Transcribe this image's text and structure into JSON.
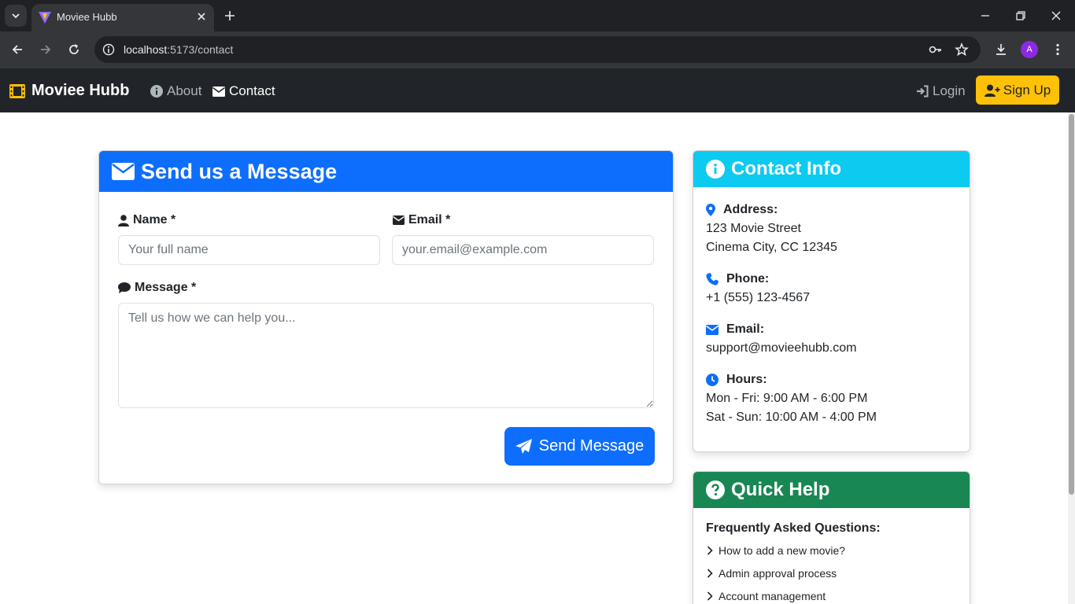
{
  "browser": {
    "tab_title": "Moviee Hubb",
    "url_host": "localhost",
    "url_path": ":5173/contact",
    "profile_initial": "A"
  },
  "navbar": {
    "brand": "Moviee Hubb",
    "about": "About",
    "contact": "Contact",
    "login": "Login",
    "signup": "Sign Up"
  },
  "message_form": {
    "title": "Send us a Message",
    "name_label": "Name *",
    "name_placeholder": "Your full name",
    "email_label": "Email *",
    "email_placeholder": "your.email@example.com",
    "message_label": "Message *",
    "message_placeholder": "Tell us how we can help you...",
    "submit": "Send Message"
  },
  "contact_info": {
    "title": "Contact Info",
    "address_label": "Address:",
    "address_line1": "123 Movie Street",
    "address_line2": "Cinema City, CC 12345",
    "phone_label": "Phone:",
    "phone": "+1 (555) 123-4567",
    "email_label": "Email:",
    "email": "support@movieehubb.com",
    "hours_label": "Hours:",
    "hours_weekday": "Mon - Fri: 9:00 AM - 6:00 PM",
    "hours_weekend": "Sat - Sun: 10:00 AM - 4:00 PM"
  },
  "quick_help": {
    "title": "Quick Help",
    "faq_title": "Frequently Asked Questions:",
    "items": [
      "How to add a new movie?",
      "Admin approval process",
      "Account management"
    ]
  },
  "colors": {
    "primary": "#0d6efd",
    "info": "#0dcaf0",
    "success": "#198754",
    "warning": "#ffc107",
    "dark": "#212529"
  }
}
